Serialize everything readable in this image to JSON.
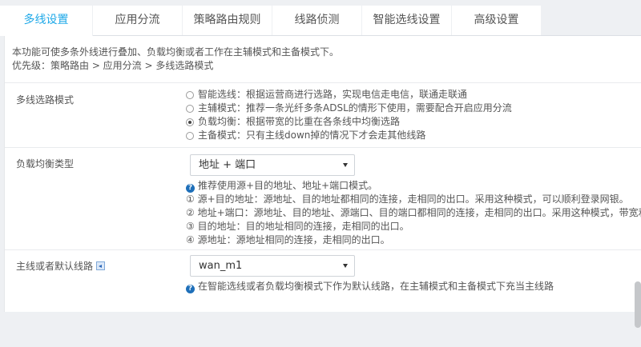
{
  "tabs": [
    {
      "label": "多线设置",
      "active": true
    },
    {
      "label": "应用分流",
      "active": false
    },
    {
      "label": "策略路由规则",
      "active": false
    },
    {
      "label": "线路侦测",
      "active": false
    },
    {
      "label": "智能选线设置",
      "active": false
    },
    {
      "label": "高级设置",
      "active": false
    }
  ],
  "intro": {
    "line1": "本功能可使多条外线进行叠加、负载均衡或者工作在主辅模式和主备模式下。",
    "line2": "优先级：策略路由 > 应用分流 > 多线选路模式"
  },
  "mode": {
    "label": "多线选路模式",
    "options": [
      {
        "text": "智能选线：根据运营商进行选路，实现电信走电信，联通走联通",
        "checked": false
      },
      {
        "text": "主辅模式：推荐一条光纤多条ADSL的情形下使用，需要配合开启应用分流",
        "checked": false
      },
      {
        "text": "负载均衡：根据带宽的比重在各条线中均衡选路",
        "checked": true
      },
      {
        "text": "主备模式：只有主线down掉的情况下才会走其他线路",
        "checked": false
      }
    ]
  },
  "balance": {
    "label": "负载均衡类型",
    "selected": "地址 + 端口",
    "help": [
      "推荐使用源+目的地址、地址+端口模式。",
      "① 源+目的地址：源地址、目的地址都相同的连接，走相同的出口。采用这种模式，可以顺利登录网银。",
      "② 地址+端口：源地址、目的地址、源端口、目的端口都相同的连接，走相同的出口。采用这种模式，带宽利",
      "③ 目的地址：目的地址相同的连接，走相同的出口。",
      "④ 源地址：源地址相同的连接，走相同的出口。"
    ]
  },
  "default_line": {
    "label": "主线或者默认线路",
    "selected": "wan_m1",
    "help": "在智能选线或者负载均衡模式下作为默认线路，在主辅模式和主备模式下充当主线路"
  },
  "colors": {
    "accent": "#1da8e8",
    "help_icon": "#1e6fb9"
  }
}
